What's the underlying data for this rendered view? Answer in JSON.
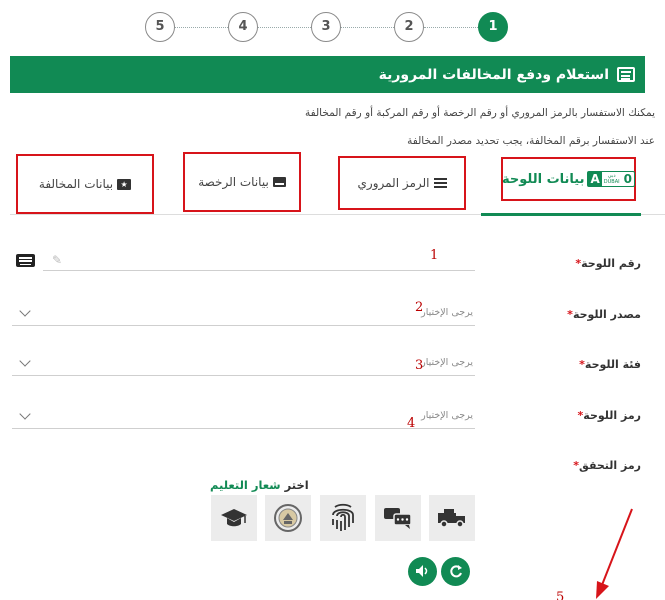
{
  "stepper": {
    "steps": [
      "1",
      "2",
      "3",
      "4",
      "5"
    ],
    "active_index": 0
  },
  "header": {
    "title": "استعلام ودفع المخالفات المرورية",
    "icon": "form-window-icon"
  },
  "description": {
    "line1": "يمكنك الاستفسار بالرمز المروري أو رقم الرخصة أو رقم المركبة أو رقم المخالفة",
    "line2": "عند الاستفسار برقم المخالفة، يجب تحديد مصدر المخالفة"
  },
  "tabs": [
    {
      "label": "بيانات اللوحة",
      "icon": "plate-icon",
      "active": true,
      "plate_icon_text": {
        "letter": "A",
        "emirate_ar": "دبي",
        "emirate_en": "DUBAI",
        "number": "0"
      }
    },
    {
      "label": "الرمز المروري",
      "icon": "list-icon",
      "active": false
    },
    {
      "label": "بيانات الرخصة",
      "icon": "license-card-icon",
      "active": false
    },
    {
      "label": "بيانات المخالفة",
      "icon": "fine-ticket-icon",
      "active": false
    }
  ],
  "form": {
    "plate_number": {
      "label": "رقم اللوحة",
      "required": "*",
      "value": ""
    },
    "plate_source": {
      "label": "مصدر اللوحة",
      "required": "*",
      "placeholder": "يرجى الإختيار"
    },
    "plate_category": {
      "label": "فئة اللوحة",
      "required": "*",
      "placeholder": "يرجى الإختيار"
    },
    "plate_code": {
      "label": "رمز اللوحة",
      "required": "*",
      "placeholder": "يرجى الإختيار"
    },
    "verification": {
      "label": "رمز التحقق",
      "required": "*"
    }
  },
  "annotations": [
    "1",
    "2",
    "3",
    "4",
    "5"
  ],
  "captcha": {
    "prompt_black": "اختر",
    "prompt_green": "شعار التعليم",
    "tiles": [
      "truck-icon",
      "chat-icon",
      "fingerprint-icon",
      "emblem-icon",
      "graduation-cap-icon"
    ],
    "buttons": [
      "audio-icon",
      "refresh-icon"
    ]
  },
  "colors": {
    "accent": "#118a54",
    "highlight_box": "#d7141a",
    "annotation": "#bb0000"
  }
}
